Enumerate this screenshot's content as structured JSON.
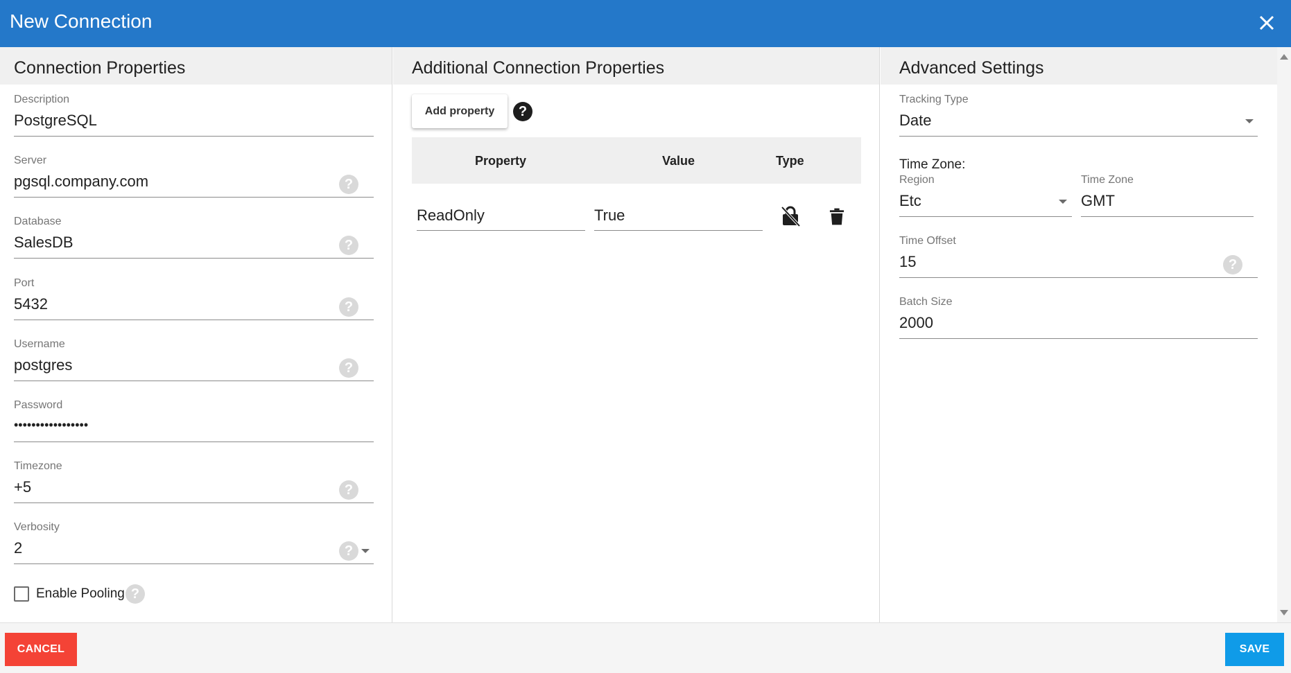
{
  "dialog": {
    "title": "New Connection",
    "header_color": "#2478c9",
    "close_icon": "close-icon"
  },
  "connection": {
    "heading": "Connection Properties",
    "fields": {
      "description": {
        "label": "Description",
        "value": "PostgreSQL"
      },
      "server": {
        "label": "Server",
        "value": "pgsql.company.com"
      },
      "database": {
        "label": "Database",
        "value": "SalesDB"
      },
      "port": {
        "label": "Port",
        "value": "5432"
      },
      "username": {
        "label": "Username",
        "value": "postgres"
      },
      "password": {
        "label": "Password",
        "value": "•••••••••••••••••"
      },
      "timezone": {
        "label": "Timezone",
        "value": "+5"
      },
      "verbosity": {
        "label": "Verbosity",
        "value": "2"
      }
    },
    "enable_pooling": {
      "label": "Enable Pooling",
      "checked": false
    }
  },
  "additional": {
    "heading": "Additional Connection Properties",
    "add_button": "Add property",
    "columns": {
      "property": "Property",
      "value": "Value",
      "type": "Type"
    },
    "rows": [
      {
        "property": "ReadOnly",
        "value": "True",
        "type_icon": "lock-icon",
        "delete_icon": "trash-icon"
      }
    ]
  },
  "advanced": {
    "heading": "Advanced Settings",
    "tracking_type": {
      "label": "Tracking Type",
      "value": "Date"
    },
    "time_zone_label": "Time Zone:",
    "region": {
      "label": "Region",
      "value": "Etc"
    },
    "time_zone": {
      "label": "Time Zone",
      "value": "GMT"
    },
    "time_offset": {
      "label": "Time Offset",
      "value": "15"
    },
    "batch_size": {
      "label": "Batch Size",
      "value": "2000"
    }
  },
  "footer": {
    "cancel": "CANCEL",
    "save": "SAVE",
    "cancel_color": "#f44336",
    "save_color": "#0f9be8"
  },
  "help_glyph": "?"
}
